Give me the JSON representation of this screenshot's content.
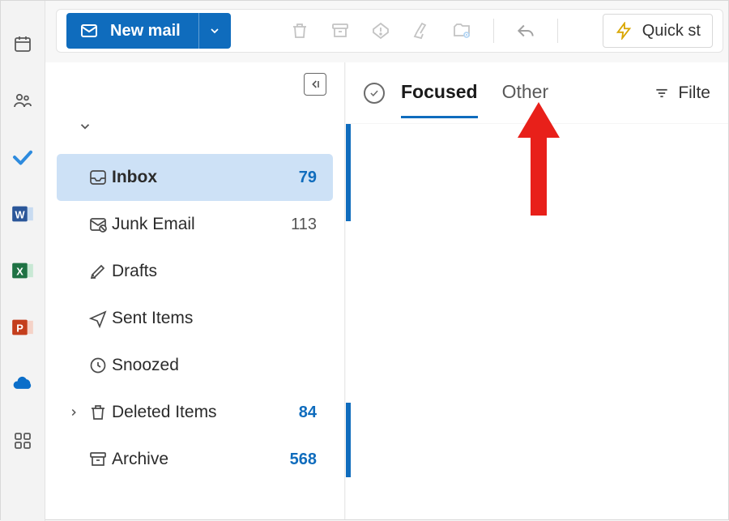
{
  "toolbar": {
    "new_mail_label": "New mail",
    "quick_steps_label": "Quick st"
  },
  "tabs": {
    "focused": "Focused",
    "other": "Other"
  },
  "filter_label": "Filte",
  "folders": [
    {
      "icon": "inbox",
      "name": "Inbox",
      "count": "79",
      "selected": true,
      "expandable": false,
      "bold": true
    },
    {
      "icon": "junk",
      "name": "Junk Email",
      "count": "113",
      "selected": false,
      "expandable": false,
      "bold": false
    },
    {
      "icon": "drafts",
      "name": "Drafts",
      "count": "",
      "selected": false,
      "expandable": false,
      "bold": false
    },
    {
      "icon": "sent",
      "name": "Sent Items",
      "count": "",
      "selected": false,
      "expandable": false,
      "bold": false
    },
    {
      "icon": "snoozed",
      "name": "Snoozed",
      "count": "",
      "selected": false,
      "expandable": false,
      "bold": false
    },
    {
      "icon": "deleted",
      "name": "Deleted Items",
      "count": "84",
      "selected": false,
      "expandable": true,
      "bold": true
    },
    {
      "icon": "archive",
      "name": "Archive",
      "count": "568",
      "selected": false,
      "expandable": false,
      "bold": true
    }
  ]
}
